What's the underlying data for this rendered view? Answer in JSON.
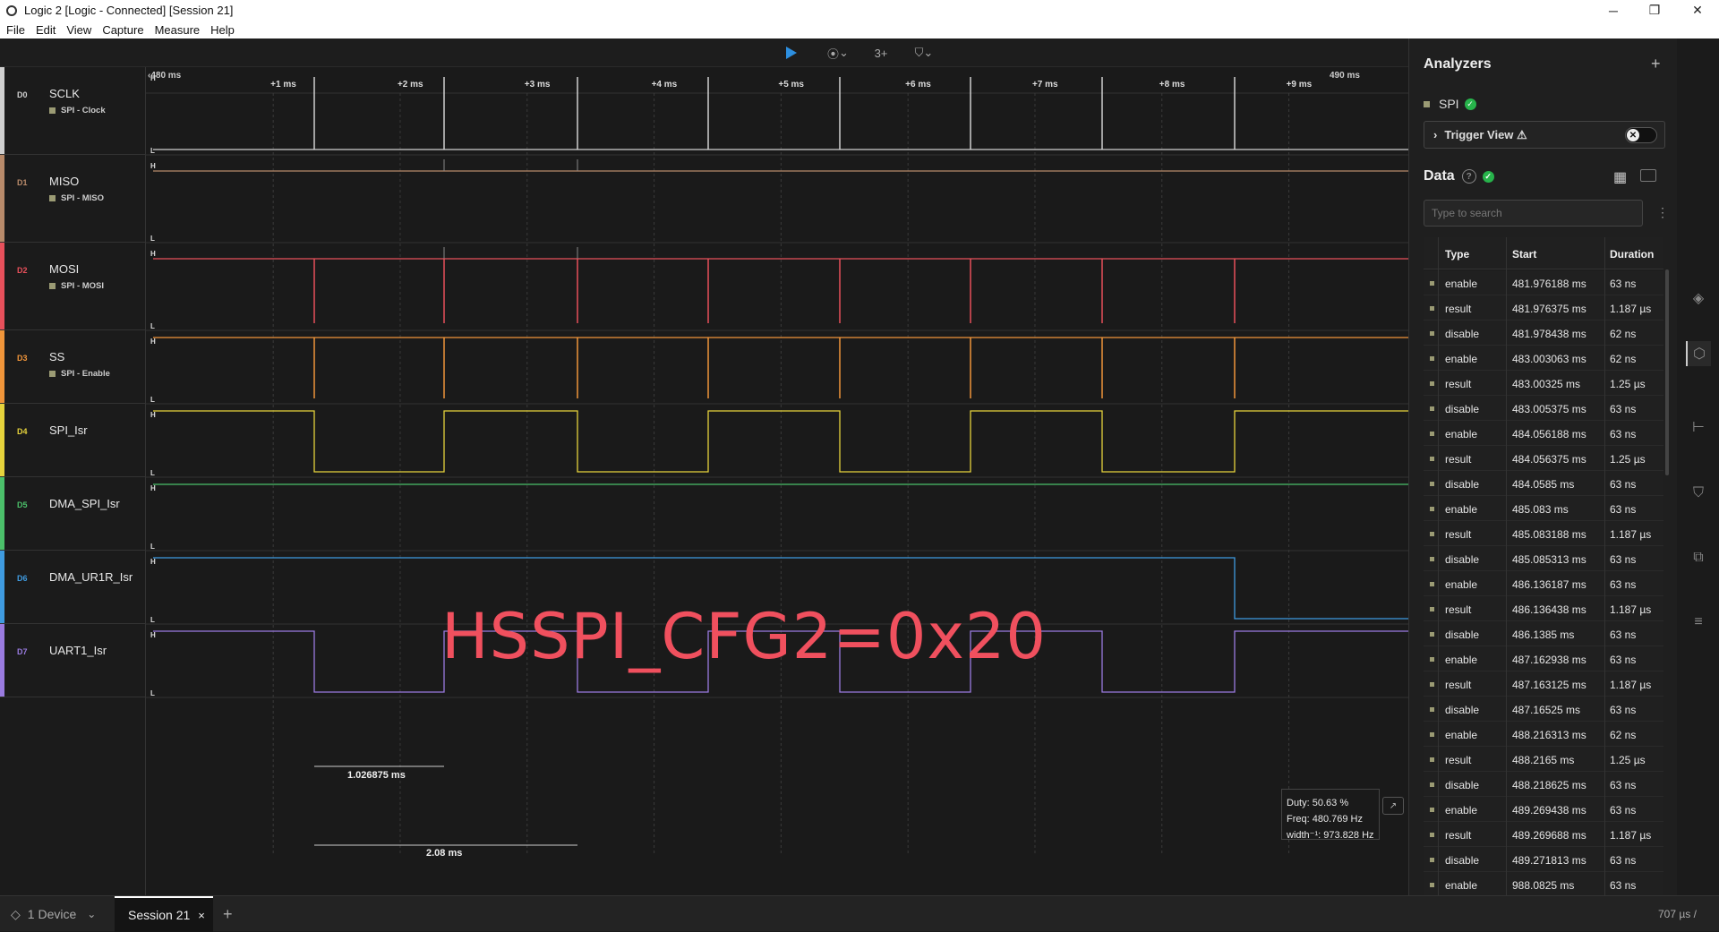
{
  "window": {
    "title": "Logic 2 [Logic - Connected] [Session 21]",
    "minimize": "─",
    "maximize": "❐",
    "close": "✕"
  },
  "menu": [
    "File",
    "Edit",
    "View",
    "Capture",
    "Measure",
    "Help"
  ],
  "toolbar": {
    "play_icon": "play-icon",
    "capture_glyph": "⦿",
    "marker_glyph": "3+",
    "trigger_glyph": "⛉"
  },
  "timeline": {
    "start_label": "‹480 ms",
    "end_label": "490 ms",
    "ticks": [
      "+1 ms",
      "+2 ms",
      "+3 ms",
      "+4 ms",
      "+5 ms",
      "+6 ms",
      "+7 ms",
      "+8 ms",
      "+9 ms"
    ]
  },
  "channels": [
    {
      "index": "D0",
      "name": "SCLK",
      "analyzer": "SPI - Clock",
      "color": "#d0d0d0"
    },
    {
      "index": "D1",
      "name": "MISO",
      "analyzer": "SPI - MISO",
      "color": "#b88a6a"
    },
    {
      "index": "D2",
      "name": "MOSI",
      "analyzer": "SPI - MOSI",
      "color": "#e8505b"
    },
    {
      "index": "D3",
      "name": "SS",
      "analyzer": "SPI - Enable",
      "color": "#f0953a"
    },
    {
      "index": "D4",
      "name": "SPI_Isr",
      "analyzer": "",
      "color": "#e6d33c"
    },
    {
      "index": "D5",
      "name": "DMA_SPI_Isr",
      "analyzer": "",
      "color": "#4bc06a"
    },
    {
      "index": "D6",
      "name": "DMA_UR1R_Isr",
      "analyzer": "",
      "color": "#3f9be0"
    },
    {
      "index": "D7",
      "name": "UART1_Isr",
      "analyzer": "",
      "color": "#9a7be0"
    }
  ],
  "level_high": "H",
  "level_low": "L",
  "overlay_text": "HSSPI_CFG2=0x20",
  "measurements": {
    "width_label": "1.026875 ms",
    "period_label": "2.08 ms"
  },
  "measure_popup": {
    "duty": "Duty: 50.63 %",
    "freq": "Freq: 480.769 Hz",
    "width": "width⁻¹: 973.828 Hz"
  },
  "analyzers": {
    "title": "Analyzers",
    "add_icon": "+",
    "items": [
      {
        "name": "SPI"
      }
    ],
    "trigger_view": "Trigger View ⚠"
  },
  "data_panel": {
    "title": "Data",
    "search_placeholder": "Type to search",
    "columns": [
      "Type",
      "Start",
      "Duration"
    ],
    "rows": [
      [
        "enable",
        "481.976188 ms",
        "63 ns"
      ],
      [
        "result",
        "481.976375 ms",
        "1.187 µs"
      ],
      [
        "disable",
        "481.978438 ms",
        "62 ns"
      ],
      [
        "enable",
        "483.003063 ms",
        "62 ns"
      ],
      [
        "result",
        "483.00325 ms",
        "1.25 µs"
      ],
      [
        "disable",
        "483.005375 ms",
        "63 ns"
      ],
      [
        "enable",
        "484.056188 ms",
        "63 ns"
      ],
      [
        "result",
        "484.056375 ms",
        "1.25 µs"
      ],
      [
        "disable",
        "484.0585 ms",
        "63 ns"
      ],
      [
        "enable",
        "485.083 ms",
        "63 ns"
      ],
      [
        "result",
        "485.083188 ms",
        "1.187 µs"
      ],
      [
        "disable",
        "485.085313 ms",
        "63 ns"
      ],
      [
        "enable",
        "486.136187 ms",
        "63 ns"
      ],
      [
        "result",
        "486.136438 ms",
        "1.187 µs"
      ],
      [
        "disable",
        "486.1385 ms",
        "63 ns"
      ],
      [
        "enable",
        "487.162938 ms",
        "63 ns"
      ],
      [
        "result",
        "487.163125 ms",
        "1.187 µs"
      ],
      [
        "disable",
        "487.16525 ms",
        "63 ns"
      ],
      [
        "enable",
        "488.216313 ms",
        "62 ns"
      ],
      [
        "result",
        "488.2165 ms",
        "1.25 µs"
      ],
      [
        "disable",
        "488.218625 ms",
        "63 ns"
      ],
      [
        "enable",
        "489.269438 ms",
        "63 ns"
      ],
      [
        "result",
        "489.269688 ms",
        "1.187 µs"
      ],
      [
        "disable",
        "489.271813 ms",
        "63 ns"
      ],
      [
        "enable",
        "988.0825 ms",
        "63 ns"
      ]
    ]
  },
  "bottom_bar": {
    "device": "1 Device",
    "session": "Session 21",
    "close": "×",
    "add": "+",
    "zoom": "707 µs /"
  }
}
